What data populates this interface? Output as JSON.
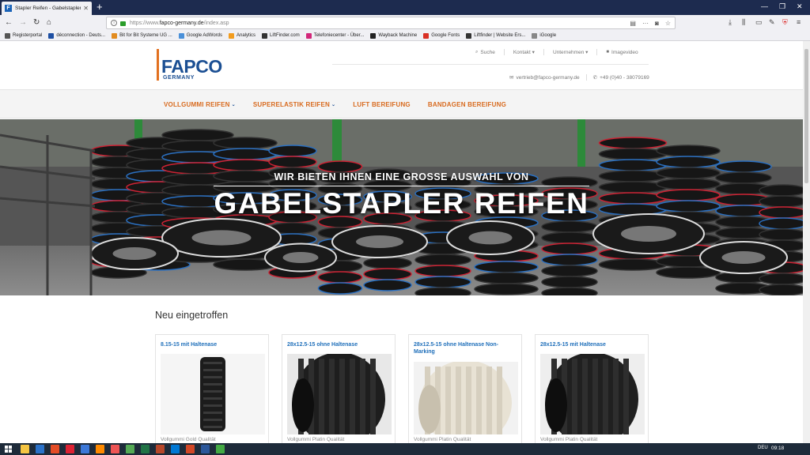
{
  "browser": {
    "tab_title": "Stapler Reifen - Gabelstapler -",
    "tab_favicon_letter": "F",
    "url_scheme": "https://www.",
    "url_domain": "fapco-germany.de",
    "url_path": "/index.asp",
    "bookmarks": [
      {
        "label": "Registerportal",
        "color": "#555555"
      },
      {
        "label": "déconnection - Deuts...",
        "color": "#1e4fa3"
      },
      {
        "label": "Bit for Bit Systeme UG ...",
        "color": "#e28b1e"
      },
      {
        "label": "Google AdWords",
        "color": "#4a90d9"
      },
      {
        "label": "Analytics",
        "color": "#f29c1e"
      },
      {
        "label": "LiftFinder.com",
        "color": "#333333"
      },
      {
        "label": "Telefoniecenter - Über...",
        "color": "#d2277a"
      },
      {
        "label": "Wayback Machine",
        "color": "#222222"
      },
      {
        "label": "Google Fonts",
        "color": "#d93025"
      },
      {
        "label": "Liftfinder | Website Ers...",
        "color": "#333333"
      },
      {
        "label": "iGoogle",
        "color": "#888888"
      }
    ]
  },
  "site": {
    "logo_text": "FAPCO",
    "logo_sub": "GERMANY",
    "top_menu": [
      {
        "label": "Suche",
        "icon": "search-icon",
        "glyph": "🔍"
      },
      {
        "label": "Kontakt ▾",
        "icon": "",
        "glyph": ""
      },
      {
        "label": "Unternehmen ▾",
        "icon": "",
        "glyph": ""
      },
      {
        "label": "Imagevideo",
        "icon": "video-icon",
        "glyph": "■"
      }
    ],
    "email": "vertrieb@fapco-germany.de",
    "phone": "+49 (0)40 - 38079169",
    "main_nav": [
      {
        "label": "VOLLGUMMI REIFEN",
        "caret": true
      },
      {
        "label": "SUPERELASTIK REIFEN",
        "caret": true
      },
      {
        "label": "LUFT BEREIFUNG",
        "caret": false
      },
      {
        "label": "BANDAGEN BEREIFUNG",
        "caret": false
      }
    ],
    "hero_subtitle": "WIR BIETEN IHNEN EINE GROSSE AUSWAHL VON",
    "hero_title": "GABELSTAPLER REIFEN",
    "section_title": "Neu eingetroffen",
    "products": [
      {
        "title": "8.15-15 mit Haltenase",
        "subtitle": "Vollgummi Gold Qualität",
        "tire_color": "#1c1c1c",
        "img_bg": "#f5f5f5"
      },
      {
        "title": "28x12.5-15 ohne Haltenase",
        "subtitle": "Vollgummi Platin Qualität",
        "tire_color": "#1e1e1e",
        "img_bg": "#e8e8e8"
      },
      {
        "title": "28x12.5-15 ohne Haltenase Non-Marking",
        "subtitle": "Vollgummi Platin Qualität",
        "tire_color": "#e8e2d4",
        "img_bg": "#f2f2f2"
      },
      {
        "title": "28x12.5-15 mit Haltenase",
        "subtitle": "Vollgummi Platin Qualität",
        "tire_color": "#202020",
        "img_bg": "#eeeeee"
      }
    ]
  },
  "taskbar": {
    "lang": "DEU",
    "time": "09:18"
  },
  "colors": {
    "accent_orange": "#d86a1e",
    "brand_blue": "#1b4f93",
    "link_blue": "#1f6fba"
  }
}
